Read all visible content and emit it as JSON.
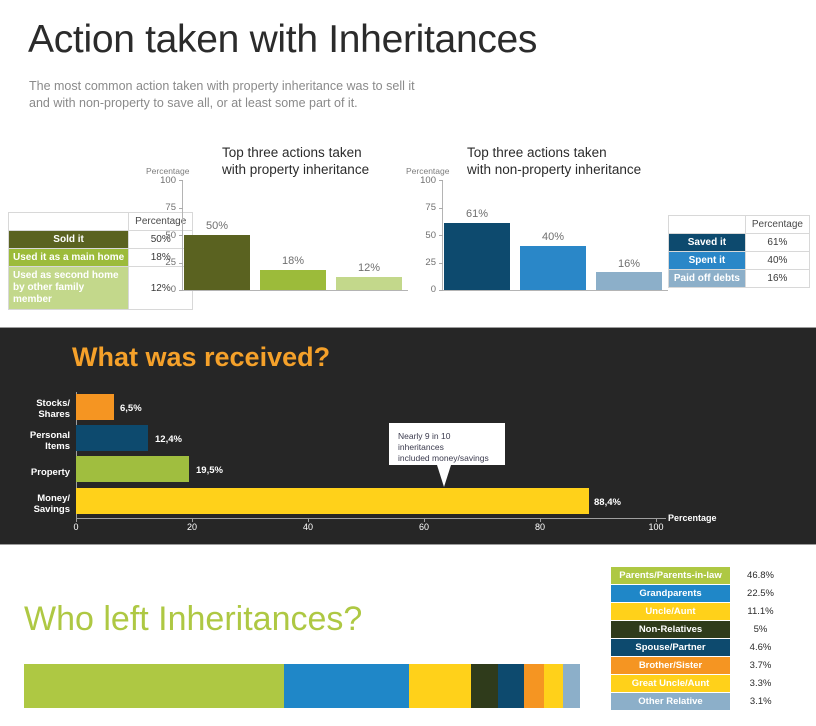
{
  "header": {
    "title": "Action taken with Inheritances",
    "subtitle_line1": "The most common action taken with property inheritance was to sell it",
    "subtitle_line2": "and with non-property to save all, or at least some part of it."
  },
  "section_property": {
    "chart_title_line1": "Top three actions taken",
    "chart_title_line2": "with property inheritance",
    "axis_label": "Percentage",
    "table": {
      "header_blank": "",
      "header_value": "Percentage",
      "rows": [
        {
          "label": "Sold it",
          "value": "50%",
          "color": "#5A6220",
          "text_color": "#ffffff"
        },
        {
          "label": "Used it as a main home",
          "value": "18%",
          "color": "#9CBB3A",
          "text_color": "#ffffff"
        },
        {
          "label": "Used as second home\nby other family member",
          "value": "12%",
          "color": "#C3D88B",
          "text_color": "#ffffff"
        }
      ]
    }
  },
  "section_nonproperty": {
    "chart_title_line1": "Top three actions taken",
    "chart_title_line2": "with non-property inheritance",
    "axis_label": "Percentage",
    "table": {
      "header_blank": "",
      "header_value": "Percentage",
      "rows": [
        {
          "label": "Saved it",
          "value": "61%",
          "color": "#0D4A6E",
          "text_color": "#ffffff"
        },
        {
          "label": "Spent it",
          "value": "40%",
          "color": "#2A87C8",
          "text_color": "#ffffff"
        },
        {
          "label": "Paid off debts",
          "value": "16%",
          "color": "#8CAFC9",
          "text_color": "#ffffff"
        }
      ]
    }
  },
  "section_received": {
    "title": "What was received?",
    "axis_label": "Percentage",
    "callout_line1": "Nearly 9 in 10 inheritances",
    "callout_line2": "included money/savings"
  },
  "section_who": {
    "title": "Who left Inheritances?",
    "legend_rows": [
      {
        "label": "Parents/Parents-in-law",
        "value": "46.8%",
        "color": "#AEC843",
        "text_color": "#ffffff"
      },
      {
        "label": "Grandparents",
        "value": "22.5%",
        "color": "#1F87C8",
        "text_color": "#ffffff"
      },
      {
        "label": "Uncle/Aunt",
        "value": "11.1%",
        "color": "#FFD11A",
        "text_color": "#ffffff"
      },
      {
        "label": "Non-Relatives",
        "value": "5%",
        "color": "#2F3B1B",
        "text_color": "#ffffff"
      },
      {
        "label": "Spouse/Partner",
        "value": "4.6%",
        "color": "#0D4A6E",
        "text_color": "#ffffff"
      },
      {
        "label": "Brother/Sister",
        "value": "3.7%",
        "color": "#F59522",
        "text_color": "#ffffff"
      },
      {
        "label": "Great Uncle/Aunt",
        "value": "3.3%",
        "color": "#FFD11A",
        "text_color": "#ffffff"
      },
      {
        "label": "Other Relative",
        "value": "3.1%",
        "color": "#8CAFC9",
        "text_color": "#ffffff"
      }
    ]
  },
  "chart_data": [
    {
      "type": "bar",
      "title": "Top three actions taken with property inheritance",
      "categories": [
        "Sold it",
        "Used it as a main home",
        "Used as second home by other family member"
      ],
      "values": [
        50,
        18,
        12
      ],
      "value_labels": [
        "50%",
        "18%",
        "12%"
      ],
      "colors": [
        "#5A6220",
        "#9CBB3A",
        "#C3D88B"
      ],
      "ylabel": "Percentage",
      "xlabel": "",
      "ylim": [
        0,
        100
      ],
      "yticks": [
        "0",
        "25",
        "50",
        "75",
        "100"
      ],
      "grid": false,
      "legend": "none"
    },
    {
      "type": "bar",
      "title": "Top three actions taken with non-property inheritance",
      "categories": [
        "Saved it",
        "Spent it",
        "Paid off debts"
      ],
      "values": [
        61,
        40,
        16
      ],
      "value_labels": [
        "61%",
        "40%",
        "16%"
      ],
      "colors": [
        "#0D4A6E",
        "#2A87C8",
        "#8CAFC9"
      ],
      "ylabel": "Percentage",
      "xlabel": "",
      "ylim": [
        0,
        100
      ],
      "yticks": [
        "0",
        "25",
        "50",
        "75",
        "100"
      ],
      "grid": false,
      "legend": "none"
    },
    {
      "type": "bar",
      "orientation": "horizontal",
      "title": "What was received?",
      "categories": [
        "Stocks/\nShares",
        "Personal\nItems",
        "Property",
        "Money/\nSavings"
      ],
      "values": [
        6.5,
        12.4,
        19.5,
        88.4
      ],
      "value_labels": [
        "6,5%",
        "12,4%",
        "19,5%",
        "88,4%"
      ],
      "colors": [
        "#F59522",
        "#0D4A6E",
        "#A0BE3F",
        "#FFD11A"
      ],
      "xlabel": "Percentage",
      "ylabel": "",
      "xlim": [
        0,
        100
      ],
      "xticks": [
        "0",
        "20",
        "40",
        "60",
        "80",
        "100"
      ],
      "grid": false,
      "legend": "none",
      "annotation": "Nearly 9 in 10 inheritances included money/savings"
    },
    {
      "type": "bar",
      "orientation": "stacked-horizontal",
      "title": "Who left Inheritances?",
      "categories": [
        "Parents/Parents-in-law",
        "Grandparents",
        "Uncle/Aunt",
        "Non-Relatives",
        "Spouse/Partner",
        "Brother/Sister",
        "Great Uncle/Aunt",
        "Other Relative"
      ],
      "values": [
        46.8,
        22.5,
        11.1,
        5,
        4.6,
        3.7,
        3.3,
        3.1
      ],
      "value_labels": [
        "46.8%",
        "22.5%",
        "11.1%",
        "5%",
        "4.6%",
        "3.7%",
        "3.3%",
        "3.1%"
      ],
      "colors": [
        "#AEC843",
        "#1F87C8",
        "#FFD11A",
        "#2F3B1B",
        "#0D4A6E",
        "#F59522",
        "#FFD11A",
        "#8CAFC9"
      ],
      "xlabel": "",
      "ylabel": "",
      "grid": false,
      "legend": "right"
    }
  ]
}
